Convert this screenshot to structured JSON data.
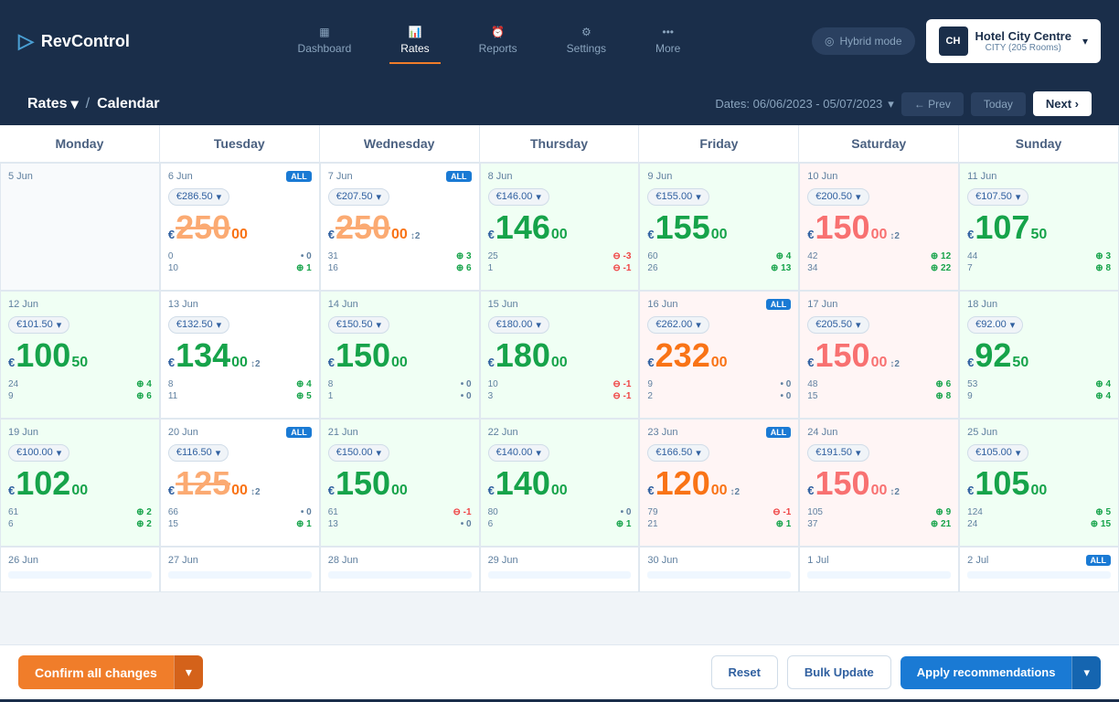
{
  "nav": {
    "logo_text": "RevControl",
    "items": [
      {
        "label": "Dashboard",
        "icon": "▦",
        "active": false
      },
      {
        "label": "Rates",
        "icon": "📊",
        "active": true
      },
      {
        "label": "Reports",
        "icon": "⏰",
        "active": false
      },
      {
        "label": "Settings",
        "icon": "⚙",
        "active": false
      },
      {
        "label": "More",
        "icon": "•••",
        "active": false
      }
    ],
    "hybrid_label": "Hybrid mode",
    "hotel_name": "Hotel City Centre",
    "hotel_sub": "CITY (205 Rooms)"
  },
  "breadcrumb": {
    "rates": "Rates",
    "calendar": "Calendar",
    "dates": "Dates: 06/06/2023 - 05/07/2023",
    "prev_label": "Prev",
    "next_label": "Next ›"
  },
  "calendar": {
    "headers": [
      "Monday",
      "Tuesday",
      "Wednesday",
      "Thursday",
      "Friday",
      "Saturday",
      "Sunday"
    ],
    "weeks": [
      {
        "days": [
          {
            "date": "5 Jun",
            "empty": true
          },
          {
            "date": "6 Jun",
            "lock": true,
            "rate_badge": "€286.50",
            "main_rate": "250",
            "dec": "00",
            "style": "orange",
            "strikethrough": true,
            "stats": [
              {
                "l": "0",
                "ld": "",
                "r": "0",
                "rd": "dot"
              },
              {
                "l": "10",
                "ld": "green",
                "r": "1",
                "rd": "green"
              }
            ]
          },
          {
            "date": "7 Jun",
            "lock": true,
            "rate_badge": "€207.50",
            "main_rate": "250",
            "dec": "00",
            "style": "orange",
            "strikethrough": true,
            "note": "2",
            "stats": [
              {
                "l": "31",
                "ld": "",
                "r": "3",
                "rd": "green"
              },
              {
                "l": "16",
                "ld": "green",
                "r": "6",
                "rd": "green"
              }
            ]
          },
          {
            "date": "8 Jun",
            "lock": false,
            "rate_badge": "€146.00",
            "main_rate": "146",
            "dec": "00",
            "style": "green",
            "bg": "green",
            "stats": [
              {
                "l": "25",
                "ld": "",
                "r": "-3",
                "rd": "red"
              },
              {
                "l": "1",
                "ld": "green",
                "r": "-1",
                "rd": "red"
              }
            ]
          },
          {
            "date": "9 Jun",
            "lock": false,
            "rate_badge": "€155.00",
            "main_rate": "155",
            "dec": "00",
            "style": "green",
            "bg": "green",
            "stats": [
              {
                "l": "60",
                "ld": "",
                "r": "4",
                "rd": "green"
              },
              {
                "l": "26",
                "ld": "green",
                "r": "13",
                "rd": "green"
              }
            ]
          },
          {
            "date": "10 Jun",
            "lock": false,
            "rate_badge": "€200.50",
            "main_rate": "150",
            "dec": "00",
            "style": "red",
            "bg": "red",
            "note": "2",
            "stats": [
              {
                "l": "42",
                "ld": "",
                "r": "12",
                "rd": "green"
              },
              {
                "l": "34",
                "ld": "green",
                "r": "22",
                "rd": "green"
              }
            ]
          },
          {
            "date": "11 Jun",
            "lock": false,
            "rate_badge": "€107.50",
            "main_rate": "107",
            "dec": "50",
            "style": "green",
            "bg": "green",
            "stats": [
              {
                "l": "44",
                "ld": "",
                "r": "3",
                "rd": "green"
              },
              {
                "l": "7",
                "ld": "green",
                "r": "8",
                "rd": "green"
              }
            ]
          }
        ]
      },
      {
        "days": [
          {
            "date": "12 Jun",
            "lock": false,
            "rate_badge": "€101.50",
            "main_rate": "100",
            "dec": "50",
            "style": "green",
            "bg": "green",
            "stats": [
              {
                "l": "24",
                "ld": "",
                "r": "4",
                "rd": "green"
              },
              {
                "l": "9",
                "ld": "green",
                "r": "6",
                "rd": "green"
              }
            ]
          },
          {
            "date": "13 Jun",
            "lock": false,
            "rate_badge": "€132.50",
            "main_rate": "134",
            "dec": "00",
            "style": "green",
            "note": "2",
            "stats": [
              {
                "l": "8",
                "ld": "",
                "r": "4",
                "rd": "green"
              },
              {
                "l": "11",
                "ld": "green",
                "r": "5",
                "rd": "green"
              }
            ]
          },
          {
            "date": "14 Jun",
            "lock": false,
            "rate_badge": "€150.50",
            "main_rate": "150",
            "dec": "00",
            "style": "green",
            "bg": "green",
            "stats": [
              {
                "l": "8",
                "ld": "",
                "r": "0",
                "rd": "dot"
              },
              {
                "l": "1",
                "ld": "green",
                "r": "0",
                "rd": "dot"
              }
            ]
          },
          {
            "date": "15 Jun",
            "lock": false,
            "rate_badge": "€180.00",
            "main_rate": "180",
            "dec": "00",
            "style": "green",
            "bg": "green",
            "stats": [
              {
                "l": "10",
                "ld": "",
                "r": "-1",
                "rd": "red"
              },
              {
                "l": "3",
                "ld": "green",
                "r": "-1",
                "rd": "red"
              }
            ]
          },
          {
            "date": "16 Jun",
            "lock": true,
            "badge_all": true,
            "rate_badge": "€262.00",
            "main_rate": "232",
            "dec": "00",
            "style": "orange",
            "bg": "red",
            "stats": [
              {
                "l": "9",
                "ld": "",
                "r": "0",
                "rd": "dot"
              },
              {
                "l": "2",
                "ld": "green",
                "r": "0",
                "rd": "dot"
              }
            ]
          },
          {
            "date": "17 Jun",
            "lock": false,
            "rate_badge": "€205.50",
            "main_rate": "150",
            "dec": "00",
            "style": "red",
            "bg": "red",
            "note": "2",
            "stats": [
              {
                "l": "48",
                "ld": "",
                "r": "6",
                "rd": "green"
              },
              {
                "l": "15",
                "ld": "green",
                "r": "8",
                "rd": "green"
              }
            ]
          },
          {
            "date": "18 Jun",
            "lock": false,
            "rate_badge": "€92.00",
            "main_rate": "92",
            "dec": "50",
            "style": "green",
            "bg": "green",
            "stats": [
              {
                "l": "53",
                "ld": "",
                "r": "4",
                "rd": "green"
              },
              {
                "l": "9",
                "ld": "green",
                "r": "4",
                "rd": "green"
              }
            ]
          }
        ]
      },
      {
        "days": [
          {
            "date": "19 Jun",
            "lock": false,
            "rate_badge": "€100.00",
            "main_rate": "102",
            "dec": "00",
            "style": "green",
            "bg": "green",
            "stats": [
              {
                "l": "61",
                "ld": "",
                "r": "2",
                "rd": "green"
              },
              {
                "l": "6",
                "ld": "green",
                "r": "2",
                "rd": "green"
              }
            ]
          },
          {
            "date": "20 Jun",
            "lock": true,
            "badge_all": true,
            "rate_badge": "€116.50",
            "main_rate": "125",
            "dec": "00",
            "style": "orange",
            "strikethrough": true,
            "note": "2",
            "stats": [
              {
                "l": "66",
                "ld": "",
                "r": "0",
                "rd": "dot"
              },
              {
                "l": "15",
                "ld": "green",
                "r": "1",
                "rd": "green"
              }
            ]
          },
          {
            "date": "21 Jun",
            "lock": false,
            "rate_badge": "€150.00",
            "main_rate": "150",
            "dec": "00",
            "style": "green",
            "bg": "green",
            "stats": [
              {
                "l": "61",
                "ld": "",
                "r": "-1",
                "rd": "red"
              },
              {
                "l": "13",
                "ld": "green",
                "r": "0",
                "rd": "dot"
              }
            ]
          },
          {
            "date": "22 Jun",
            "lock": false,
            "rate_badge": "€140.00",
            "main_rate": "140",
            "dec": "00",
            "style": "green",
            "bg": "green",
            "stats": [
              {
                "l": "80",
                "ld": "",
                "r": "0",
                "rd": "dot"
              },
              {
                "l": "6",
                "ld": "green",
                "r": "1",
                "rd": "green"
              }
            ]
          },
          {
            "date": "23 Jun",
            "lock": true,
            "badge_all": true,
            "rate_badge": "€166.50",
            "main_rate": "120",
            "dec": "00",
            "style": "orange",
            "bg": "red",
            "note": "2",
            "stats": [
              {
                "l": "79",
                "ld": "",
                "r": "-1",
                "rd": "red"
              },
              {
                "l": "21",
                "ld": "green",
                "r": "1",
                "rd": "green"
              }
            ]
          },
          {
            "date": "24 Jun",
            "lock": false,
            "rate_badge": "€191.50",
            "main_rate": "150",
            "dec": "00",
            "style": "red",
            "bg": "red",
            "note": "2",
            "stats": [
              {
                "l": "105",
                "ld": "",
                "r": "9",
                "rd": "green"
              },
              {
                "l": "37",
                "ld": "green",
                "r": "21",
                "rd": "green"
              }
            ]
          },
          {
            "date": "25 Jun",
            "lock": false,
            "rate_badge": "€105.00",
            "main_rate": "105",
            "dec": "00",
            "style": "green",
            "bg": "green",
            "stats": [
              {
                "l": "124",
                "ld": "",
                "r": "5",
                "rd": "green"
              },
              {
                "l": "24",
                "ld": "green",
                "r": "15",
                "rd": "green"
              }
            ]
          }
        ]
      },
      {
        "days": [
          {
            "date": "26 Jun",
            "lock": false,
            "partial": true
          },
          {
            "date": "27 Jun",
            "lock": false,
            "partial": true
          },
          {
            "date": "28 Jun",
            "lock": false,
            "partial": true
          },
          {
            "date": "29 Jun",
            "lock": false,
            "partial": true
          },
          {
            "date": "30 Jun",
            "lock": false,
            "partial": true
          },
          {
            "date": "1 Jul",
            "lock": false,
            "partial": true
          },
          {
            "date": "2 Jul",
            "lock": true,
            "badge_all": true,
            "partial": true
          }
        ]
      }
    ]
  },
  "bottom": {
    "confirm_label": "Confirm all changes",
    "reset_label": "Reset",
    "bulk_label": "Bulk Update",
    "apply_label": "Apply recommendations"
  }
}
